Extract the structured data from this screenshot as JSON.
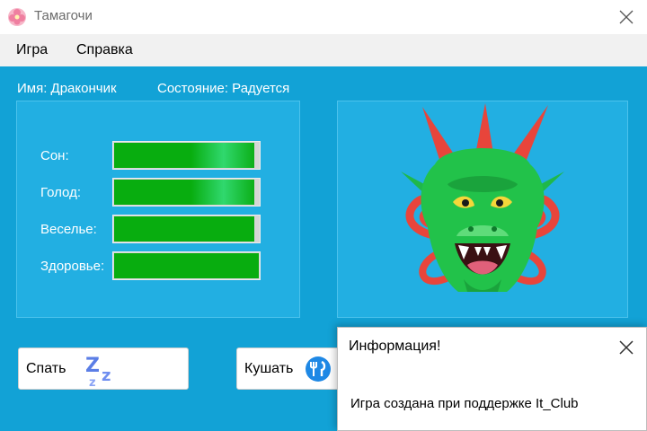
{
  "window": {
    "title": "Тамагочи",
    "icon": "cherry-blossom-icon"
  },
  "menu": {
    "items": [
      {
        "label": "Игра"
      },
      {
        "label": "Справка"
      }
    ]
  },
  "pet": {
    "name_text": "Имя: Дракончик",
    "state_text": "Состояние: Радуется",
    "image": "dragon-head-icon"
  },
  "stats": [
    {
      "label": "Сон:",
      "level": 0.97
    },
    {
      "label": "Голод:",
      "level": 0.97
    },
    {
      "label": "Веселье:",
      "level": 0.97
    },
    {
      "label": "Здоровье:",
      "level": 1.0
    }
  ],
  "actions": {
    "sleep": {
      "label": "Спать",
      "icon": "zzz-icon"
    },
    "eat": {
      "label": "Кушать",
      "icon": "fork-knife-icon"
    }
  },
  "dialog": {
    "title": "Информация!",
    "message": "Игра создана при поддержке It_Club"
  },
  "colors": {
    "client_background": "#12a2d6",
    "panel_background": "#22afe2",
    "bar_fill": "#08ad0f"
  }
}
